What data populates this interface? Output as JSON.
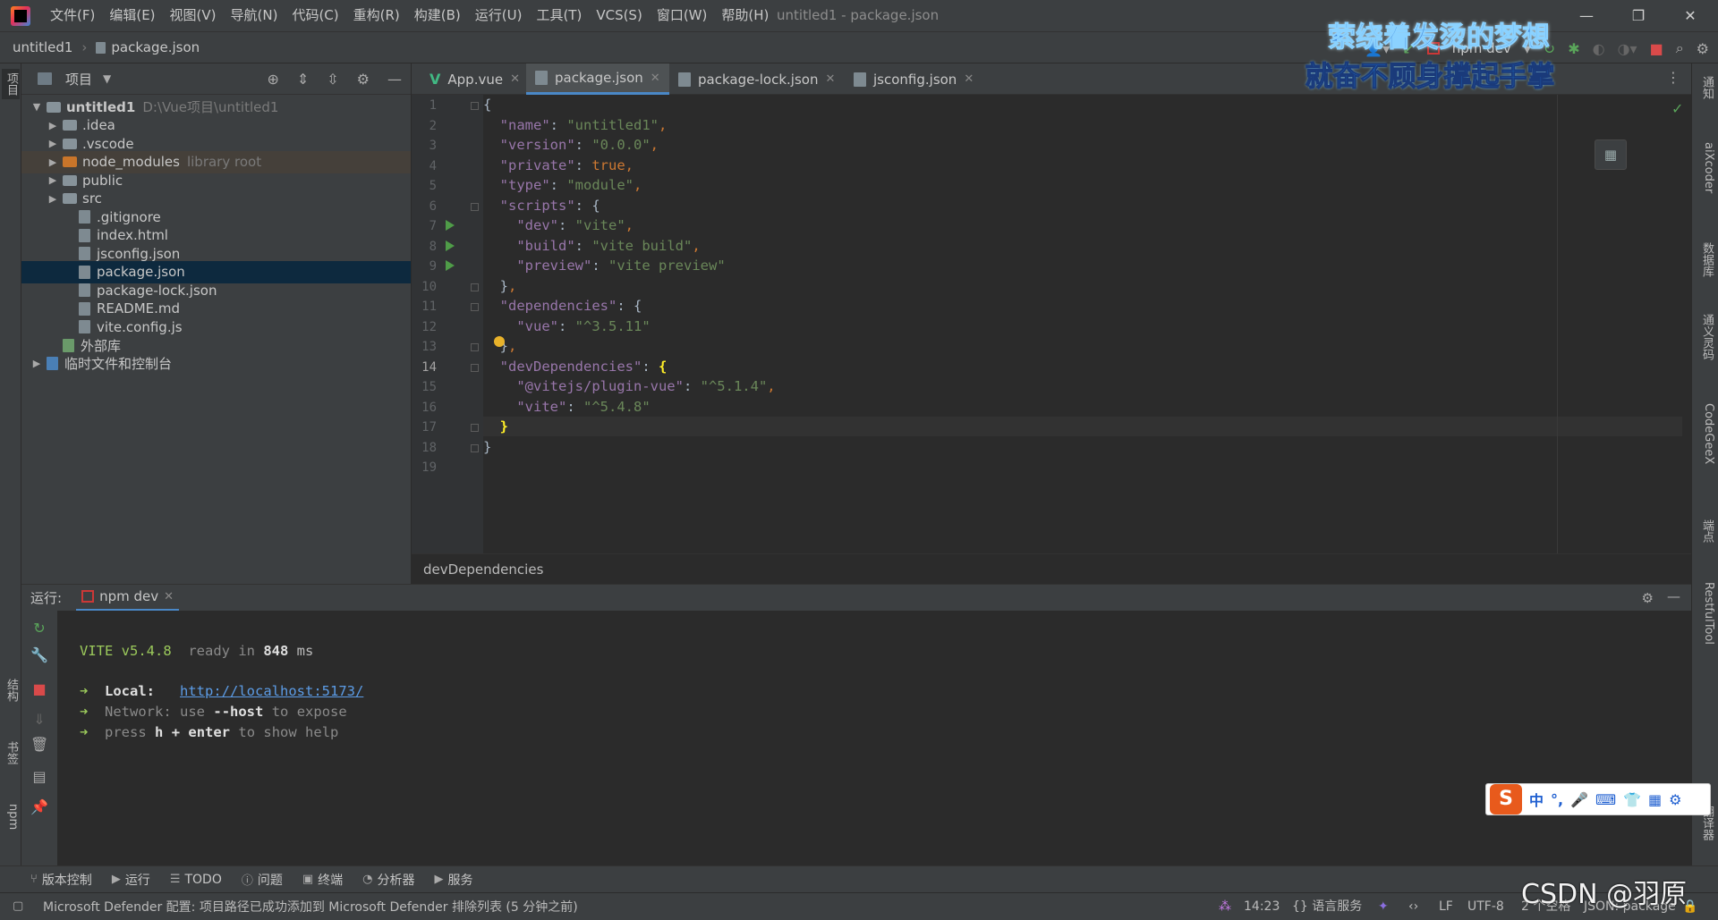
{
  "titlebar": {
    "menus": [
      "文件(F)",
      "编辑(E)",
      "视图(V)",
      "导航(N)",
      "代码(C)",
      "重构(R)",
      "构建(B)",
      "运行(U)",
      "工具(T)",
      "VCS(S)",
      "窗口(W)",
      "帮助(H)"
    ],
    "window_title": "untitled1 - package.json"
  },
  "navbar": {
    "project": "untitled1",
    "file": "package.json",
    "run_config": "npm dev"
  },
  "overlay": {
    "line1": "萦绕着发烫的梦想",
    "line2": "就奋不顾身撑起手掌"
  },
  "left_strip": {
    "top_tab": "项目",
    "structure_tab": "结构",
    "bookmarks_tab": "书签",
    "npm_tab": "npm"
  },
  "project_panel": {
    "title": "项目",
    "tree": [
      {
        "label": "untitled1",
        "extra": "D:\\Vue项目\\untitled1",
        "type": "folder",
        "level": 0,
        "expanded": true
      },
      {
        "label": ".idea",
        "type": "folder",
        "level": 1
      },
      {
        "label": ".vscode",
        "type": "folder",
        "level": 1
      },
      {
        "label": "node_modules",
        "extra": "library root",
        "type": "folder-orange",
        "level": 1
      },
      {
        "label": "public",
        "type": "folder",
        "level": 1
      },
      {
        "label": "src",
        "type": "folder",
        "level": 1
      },
      {
        "label": ".gitignore",
        "type": "file",
        "level": 2
      },
      {
        "label": "index.html",
        "type": "file",
        "level": 2
      },
      {
        "label": "jsconfig.json",
        "type": "file",
        "level": 2
      },
      {
        "label": "package.json",
        "type": "file",
        "level": 2,
        "selected": true
      },
      {
        "label": "package-lock.json",
        "type": "file",
        "level": 2
      },
      {
        "label": "README.md",
        "type": "file",
        "level": 2
      },
      {
        "label": "vite.config.js",
        "type": "file",
        "level": 2
      },
      {
        "label": "外部库",
        "type": "lib",
        "level": 1
      },
      {
        "label": "临时文件和控制台",
        "type": "scratch",
        "level": 0
      }
    ]
  },
  "editor_tabs": [
    {
      "label": "App.vue",
      "icon": "vue-icon"
    },
    {
      "label": "package.json",
      "icon": "json-icon",
      "active": true
    },
    {
      "label": "package-lock.json",
      "icon": "json-icon"
    },
    {
      "label": "jsconfig.json",
      "icon": "json-icon"
    }
  ],
  "editor": {
    "line_numbers": [
      "1",
      "2",
      "3",
      "4",
      "5",
      "6",
      "7",
      "8",
      "9",
      "10",
      "11",
      "12",
      "13",
      "14",
      "15",
      "16",
      "17",
      "18",
      "19"
    ],
    "current_line": "14",
    "breadcrumb": "devDependencies"
  },
  "right_strip": [
    "通知",
    "aiXcoder",
    "数据库",
    "通义灵码",
    "CodeGeeX",
    "端点",
    "RestfulTool",
    "翻译器"
  ],
  "run_panel": {
    "label": "运行:",
    "tab": "npm dev",
    "console": {
      "vite": "VITE v5.4.8",
      "ready": "ready in",
      "ms_value": "848",
      "ms": "ms",
      "local_label": "Local:",
      "local_url": "http://localhost:5173/",
      "network_label": "Network:",
      "network_use": "use",
      "network_flag": "--host",
      "network_rest": "to expose",
      "press": "press",
      "key": "h + enter",
      "press_rest": "to show help"
    }
  },
  "ime": {
    "s": "S",
    "lang": "中"
  },
  "tool_tabs": [
    "版本控制",
    "运行",
    "TODO",
    "问题",
    "终端",
    "分析器",
    "服务"
  ],
  "statusbar": {
    "message": "Microsoft Defender 配置: 项目路径已成功添加到 Microsoft Defender 排除列表 (5 分钟之前)",
    "position": "14:23",
    "lang_service": "{} 语言服务",
    "line_sep": "LF",
    "encoding": "UTF-8",
    "indent": "2 个空格",
    "schema": "JSON: package"
  },
  "watermark": "CSDN @羽原"
}
